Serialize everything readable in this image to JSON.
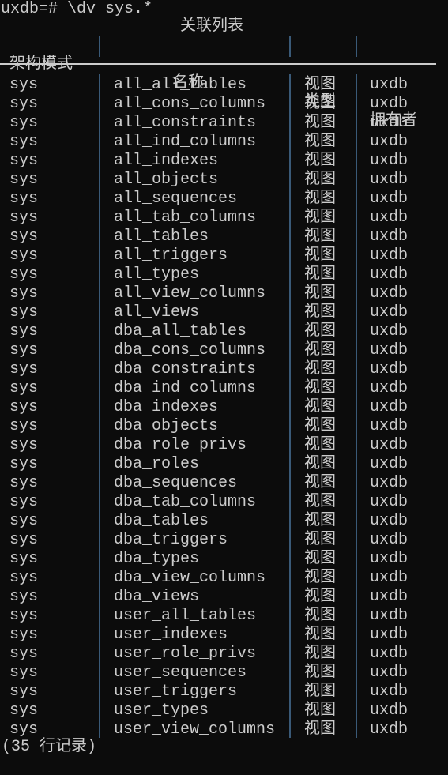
{
  "terminal": {
    "prompt": "uxdb=# \\dv sys.*",
    "table_title": "关联列表",
    "headers": [
      "架构模式",
      "名称",
      "类型",
      "拥有者"
    ],
    "rows": [
      [
        "sys",
        "all_all_tables",
        "视图",
        "uxdb"
      ],
      [
        "sys",
        "all_cons_columns",
        "视图",
        "uxdb"
      ],
      [
        "sys",
        "all_constraints",
        "视图",
        "uxdb"
      ],
      [
        "sys",
        "all_ind_columns",
        "视图",
        "uxdb"
      ],
      [
        "sys",
        "all_indexes",
        "视图",
        "uxdb"
      ],
      [
        "sys",
        "all_objects",
        "视图",
        "uxdb"
      ],
      [
        "sys",
        "all_sequences",
        "视图",
        "uxdb"
      ],
      [
        "sys",
        "all_tab_columns",
        "视图",
        "uxdb"
      ],
      [
        "sys",
        "all_tables",
        "视图",
        "uxdb"
      ],
      [
        "sys",
        "all_triggers",
        "视图",
        "uxdb"
      ],
      [
        "sys",
        "all_types",
        "视图",
        "uxdb"
      ],
      [
        "sys",
        "all_view_columns",
        "视图",
        "uxdb"
      ],
      [
        "sys",
        "all_views",
        "视图",
        "uxdb"
      ],
      [
        "sys",
        "dba_all_tables",
        "视图",
        "uxdb"
      ],
      [
        "sys",
        "dba_cons_columns",
        "视图",
        "uxdb"
      ],
      [
        "sys",
        "dba_constraints",
        "视图",
        "uxdb"
      ],
      [
        "sys",
        "dba_ind_columns",
        "视图",
        "uxdb"
      ],
      [
        "sys",
        "dba_indexes",
        "视图",
        "uxdb"
      ],
      [
        "sys",
        "dba_objects",
        "视图",
        "uxdb"
      ],
      [
        "sys",
        "dba_role_privs",
        "视图",
        "uxdb"
      ],
      [
        "sys",
        "dba_roles",
        "视图",
        "uxdb"
      ],
      [
        "sys",
        "dba_sequences",
        "视图",
        "uxdb"
      ],
      [
        "sys",
        "dba_tab_columns",
        "视图",
        "uxdb"
      ],
      [
        "sys",
        "dba_tables",
        "视图",
        "uxdb"
      ],
      [
        "sys",
        "dba_triggers",
        "视图",
        "uxdb"
      ],
      [
        "sys",
        "dba_types",
        "视图",
        "uxdb"
      ],
      [
        "sys",
        "dba_view_columns",
        "视图",
        "uxdb"
      ],
      [
        "sys",
        "dba_views",
        "视图",
        "uxdb"
      ],
      [
        "sys",
        "user_all_tables",
        "视图",
        "uxdb"
      ],
      [
        "sys",
        "user_indexes",
        "视图",
        "uxdb"
      ],
      [
        "sys",
        "user_role_privs",
        "视图",
        "uxdb"
      ],
      [
        "sys",
        "user_sequences",
        "视图",
        "uxdb"
      ],
      [
        "sys",
        "user_triggers",
        "视图",
        "uxdb"
      ],
      [
        "sys",
        "user_types",
        "视图",
        "uxdb"
      ],
      [
        "sys",
        "user_view_columns",
        "视图",
        "uxdb"
      ]
    ],
    "footer": "(35 行记录)"
  },
  "colors": {
    "background": "#0c0c0c",
    "text": "#cccccc",
    "column_separator": "#3a5a78"
  }
}
